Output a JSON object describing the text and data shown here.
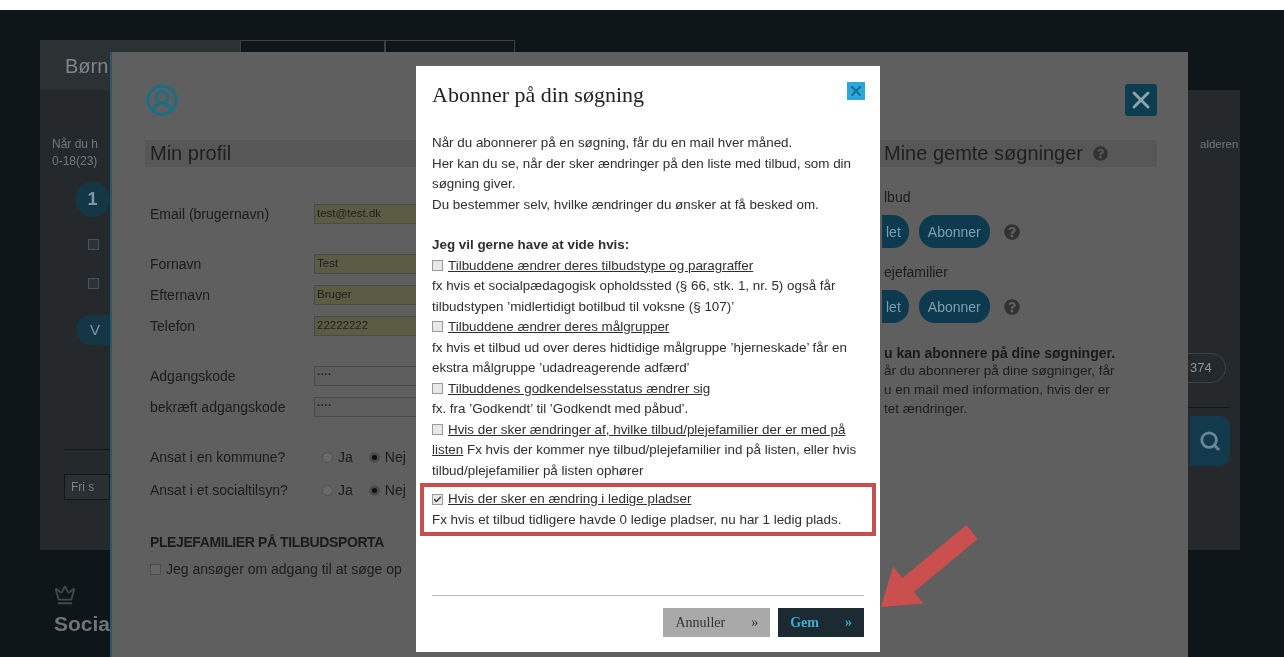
{
  "page": {
    "tabs": [
      {
        "label": "Børn",
        "selected": true
      },
      {
        "selected": false
      },
      {
        "selected": false
      }
    ],
    "intro_lines": [
      "Når du h",
      "0-18(23)"
    ],
    "step_badge": "1",
    "checkboxes": [
      {
        "checked": false
      },
      {
        "checked": false
      }
    ],
    "button_label": "V",
    "search_placeholder": "Fri s",
    "side_text": "alderen",
    "count_pill": "374",
    "footer_text": "Socia"
  },
  "profile": {
    "heading": "Min profil",
    "fields": [
      {
        "label": "Email (brugernavn)",
        "value": "test@test.dk",
        "kind": "text",
        "autofilled": true,
        "group_start": false
      },
      {
        "label": "Fornavn",
        "value": "Test",
        "kind": "text",
        "autofilled": true,
        "group_start": true
      },
      {
        "label": "Efternavn",
        "value": "Bruger",
        "kind": "text",
        "autofilled": true,
        "group_start": false
      },
      {
        "label": "Telefon",
        "value": "22222222",
        "kind": "text",
        "autofilled": true,
        "group_start": false
      },
      {
        "label": "Adgangskode",
        "value": "····",
        "kind": "password",
        "autofilled": false,
        "group_start": true
      },
      {
        "label": "bekræft adgangskode",
        "value": "····",
        "kind": "password",
        "autofilled": false,
        "group_start": false
      }
    ],
    "questions": [
      {
        "label": "Ansat i en kommune?",
        "options": [
          {
            "label": "Ja",
            "selected": false
          },
          {
            "label": "Nej",
            "selected": true
          }
        ]
      },
      {
        "label": "Ansat i et socialtilsyn?",
        "options": [
          {
            "label": "Ja",
            "selected": false
          },
          {
            "label": "Nej",
            "selected": true
          }
        ]
      }
    ],
    "section_heading": "PLEJEFAMILIER PÅ TILBUDSPORTA",
    "consent": {
      "label": "Jeg ansøger om adgang til at søge op",
      "checked": false
    }
  },
  "saved_searches": {
    "heading": "Mine gemte søgninger",
    "groups": [
      {
        "label": "lbud",
        "buttons": [
          "let",
          "Abonner"
        ]
      },
      {
        "label": "ejefamilier",
        "buttons": [
          "let",
          "Abonner"
        ]
      }
    ],
    "info": {
      "heading": "u kan abonnere på dine søgninger.",
      "lines": [
        "år du abonnerer på dine søgninger, får",
        "u en mail med information, hvis der er",
        "tet ændringer."
      ]
    }
  },
  "dialog": {
    "title": "Abonner på din søgning",
    "paragraphs": [
      "Når du abonnerer på en søgning, får du en mail hver måned.",
      "Her kan du se, når der sker ændringer på den liste med tilbud, som din søgning giver.",
      "Du bestemmer selv, hvilke ændringer du ønsker at få besked om."
    ],
    "options_heading": "Jeg vil gerne have at vide hvis:",
    "options": [
      {
        "kind": "stacked",
        "title": "Tilbuddene ændrer deres tilbudstype og paragraffer",
        "description": "fx hvis et socialpædagogisk opholdssted (§ 66, stk. 1, nr. 5) også får tilbudstypen ’midlertidigt botilbud til voksne (§ 107)’",
        "checked": false,
        "annotated": false
      },
      {
        "kind": "stacked",
        "title": "Tilbuddene ændrer deres målgrupper",
        "description": "fx hvis et tilbud ud over deres hidtidige målgruppe ’hjerneskade’ får en ekstra målgruppe ’udadreagerende adfærd’",
        "checked": false,
        "annotated": false
      },
      {
        "kind": "stacked",
        "title": "Tilbuddenes godkendelsesstatus ændrer sig",
        "description": "fx. fra ’Godkendt’ til ’Godkendt med påbud’.",
        "checked": false,
        "annotated": false
      },
      {
        "kind": "inline",
        "title": "Hvis der sker ændringer af, hvilke tilbud/plejefamilier der er med på listen",
        "description": "Fx hvis der kommer nye tilbud/plejefamilier ind på listen, eller hvis tilbud/plejefamilier på listen ophører",
        "checked": false,
        "annotated": false
      },
      {
        "kind": "stacked",
        "title": "Hvis der sker en ændring i ledige pladser",
        "description": "Fx hvis et tilbud tidligere havde 0 ledige pladser, nu har 1 ledig plads.",
        "checked": true,
        "annotated": true
      }
    ],
    "buttons": [
      {
        "label": "Annuller",
        "kind": "secondary"
      },
      {
        "label": "Gem",
        "kind": "primary"
      }
    ],
    "button_marker": "»"
  }
}
